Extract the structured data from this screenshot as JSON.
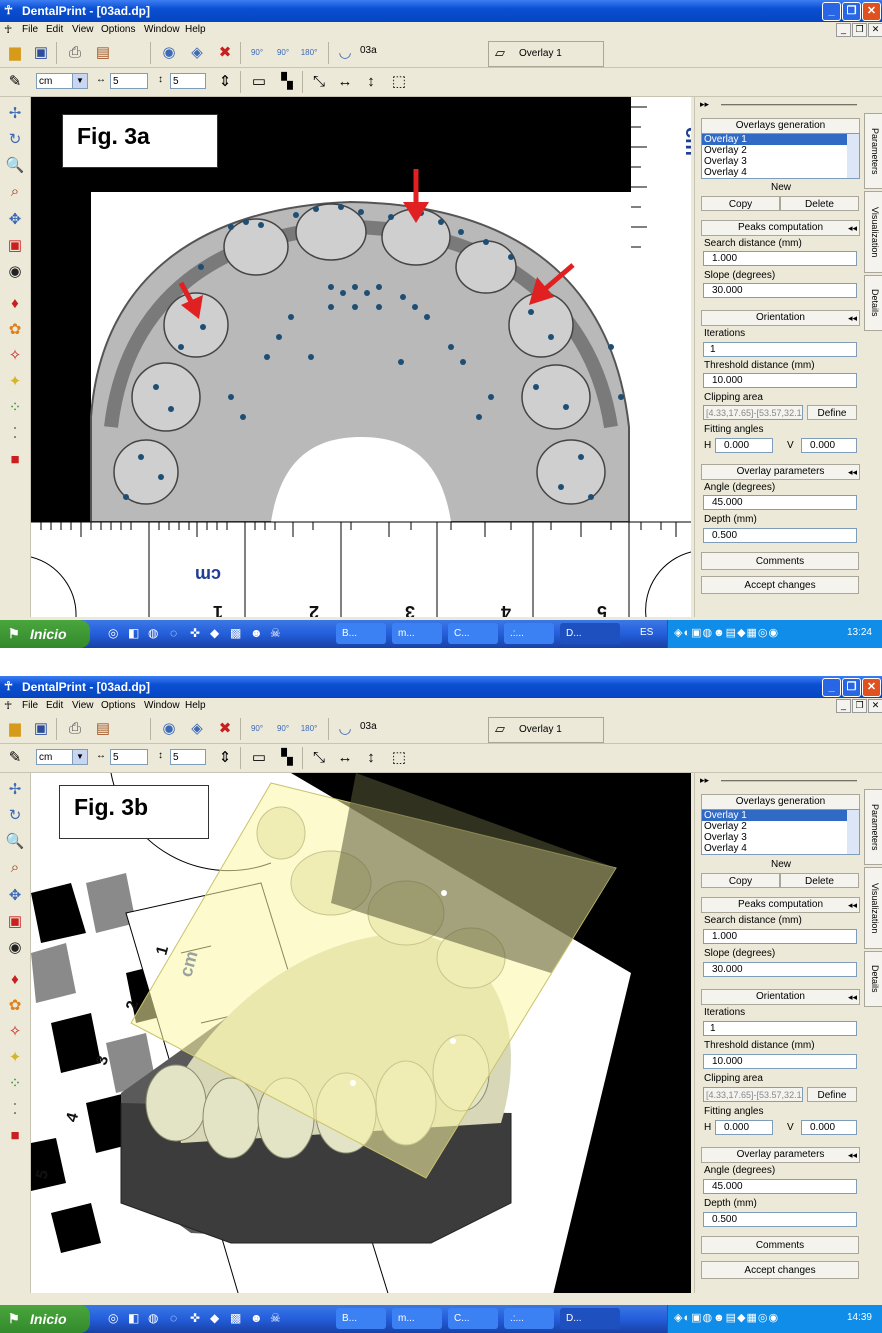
{
  "window": {
    "title": "DentalPrint - [03ad.dp]"
  },
  "menu": {
    "items": [
      "File",
      "Edit",
      "View",
      "Options",
      "Window",
      "Help"
    ]
  },
  "toolbar": {
    "model_name": "03a",
    "overlay_selector": "Overlay 1",
    "rotate_labels": [
      "90°",
      "90°",
      "180°"
    ],
    "unit": "cm",
    "width_value": "5",
    "height_value": "5"
  },
  "panel": {
    "overlays_header": "Overlays generation",
    "overlays": [
      "Overlay 1",
      "Overlay 2",
      "Overlay 3",
      "Overlay 4"
    ],
    "new_label": "New",
    "copy_label": "Copy",
    "delete_label": "Delete",
    "peaks_header": "Peaks computation",
    "search_distance_label": "Search distance (mm)",
    "search_distance": "1.000",
    "slope_label": "Slope (degrees)",
    "slope": "30.000",
    "orientation_header": "Orientation",
    "iterations_label": "Iterations",
    "iterations": "1",
    "threshold_label": "Threshold distance (mm)",
    "threshold": "10.000",
    "clipping_label": "Clipping area",
    "define_label": "Define",
    "fitting_label": "Fitting angles",
    "h_label": "H",
    "v_label": "V",
    "h_value": "0.000",
    "v_value": "0.000",
    "overlay_params_header": "Overlay parameters",
    "angle_label": "Angle (degrees)",
    "angle": "45.000",
    "depth_label": "Depth (mm)",
    "depth": "0.500",
    "comments_label": "Comments",
    "accept_label": "Accept changes",
    "tabs": [
      "Parameters",
      "Visualization",
      "Details"
    ]
  },
  "taskbar": {
    "start_label": "Inicio",
    "tasks": [
      "B...",
      "m...",
      "C...",
      ".:...",
      "D..."
    ],
    "language": "ES"
  },
  "screen_a": {
    "figure_label": "Fig. 3a",
    "clipping_value": "[4.33,17.65]-[53.57,32.1",
    "clock": "13:24",
    "ruler_unit": "cm",
    "ruler_numbers": [
      "1",
      "2",
      "3",
      "4",
      "5"
    ]
  },
  "screen_b": {
    "figure_label": "Fig. 3b",
    "clipping_value": "[4.33,17.65]-[53.57,32.1",
    "clock": "14:39",
    "ruler_unit": "cm",
    "ruler_numbers": [
      "1",
      "2",
      "3",
      "4",
      "5"
    ]
  }
}
